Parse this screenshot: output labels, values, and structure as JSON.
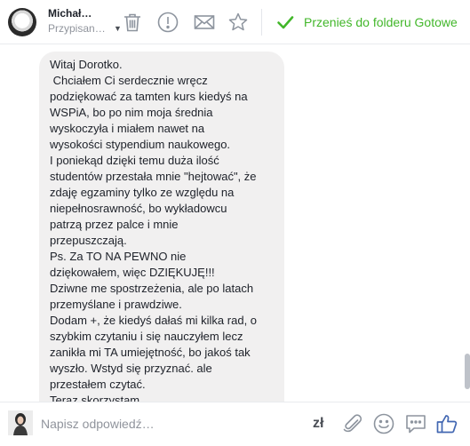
{
  "header": {
    "contact_name": "Michał…",
    "contact_status": "Przypisan…",
    "move_to_folder_label": "Przenieś do folderu Gotowe",
    "toolbar_icons": [
      "trash-icon",
      "alert-icon",
      "envelope-icon",
      "star-icon"
    ],
    "accent_color": "#42b72a"
  },
  "message": {
    "lines": [
      "Witaj Dorotko.",
      " Chciałem Ci serdecznie wręcz",
      "podziękować za tamten kurs kiedyś na",
      "WSPiA, bo po nim moja średnia",
      "wyskoczyła i miałem nawet na",
      "wysokości stypendium naukowego.",
      "I poniekąd dzięki temu duża ilość",
      "studentów przestała mnie \"hejtować\", że",
      "zdaję egzaminy tylko ze względu na",
      "niepełnosrawność, bo wykładowcu",
      "patrzą przez palce i mnie",
      "przepuszczają.",
      "Ps. Za TO NA PEWNO nie",
      "dziękowałem, więc DZIĘKUJĘ!!!",
      "Dziwne me spostrzeżenia, ale po latach",
      "przemyślane i prawdziwe.",
      "Dodam +, że kiedyś dałaś mi kilka rad, o",
      "szybkim czytaniu i się nauczyłem lecz",
      "zanikła mi TA umiejętność, bo jakoś tak",
      "wyszło. Wstyd się przyznać. ale",
      "przestałem czytać.",
      "Teraz skorzystam"
    ]
  },
  "composer": {
    "placeholder": "Napisz odpowiedź…",
    "value": "",
    "currency_label": "zł",
    "icons": [
      "attachment-icon",
      "emoji-icon",
      "saved-replies-icon",
      "like-icon"
    ],
    "like_color": "#4267b2"
  }
}
